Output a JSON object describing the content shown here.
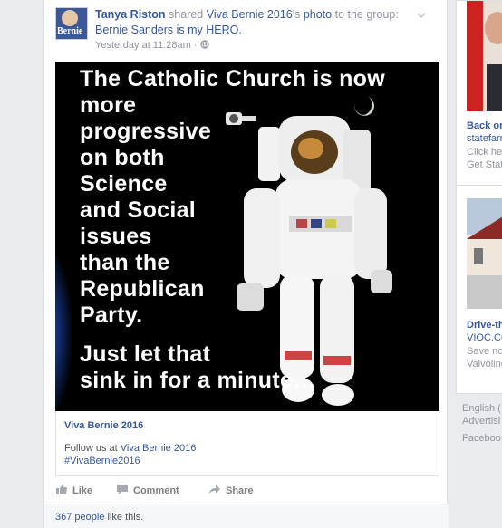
{
  "post": {
    "author": "Tanya Riston",
    "shared_text": " shared ",
    "page_name": "Viva Bernie 2016",
    "possessive_text": "'s ",
    "object_link": "photo",
    "to_group_text": " to the group: ",
    "group_name": "Bernie Sanders is my HERO.",
    "timestamp": "Yesterday at 11:28am",
    "separator": " · ",
    "avatar_text": "Bernie",
    "image_lines": [
      "The Catholic Church is now",
      "more",
      "progressive",
      "on both",
      "Science",
      "and Social",
      "issues",
      "than the",
      "Republican",
      "Party.",
      "Just let that",
      "sink in for a minute…"
    ],
    "attribution": {
      "title": "Viva Bernie 2016",
      "follow_text": "Follow us at ",
      "follow_link": "Viva Bernie 2016",
      "hashtag": "#VivaBernie2016"
    },
    "actions": {
      "like": "Like",
      "comment": "Comment",
      "share": "Share"
    },
    "likes": {
      "count": "367 people",
      "suffix": " like this."
    }
  },
  "sidebar": {
    "ad1": {
      "title": "Back or",
      "domain": "statefarr",
      "line1": "Click her",
      "line2": "Get State"
    },
    "ad2": {
      "title": "Drive-th",
      "domain": "VIOC.CO",
      "line1": "Save no",
      "line2": "Valvoline"
    },
    "footer": {
      "language": "English (",
      "advertising": "Advertisi",
      "brand": "Faceboo"
    }
  },
  "colors": {
    "link": "#365899",
    "muted": "#90949c",
    "background": "#e9ebee"
  },
  "icons": [
    "chevron-down-icon",
    "globe-icon",
    "like-icon",
    "comment-icon",
    "share-icon"
  ]
}
